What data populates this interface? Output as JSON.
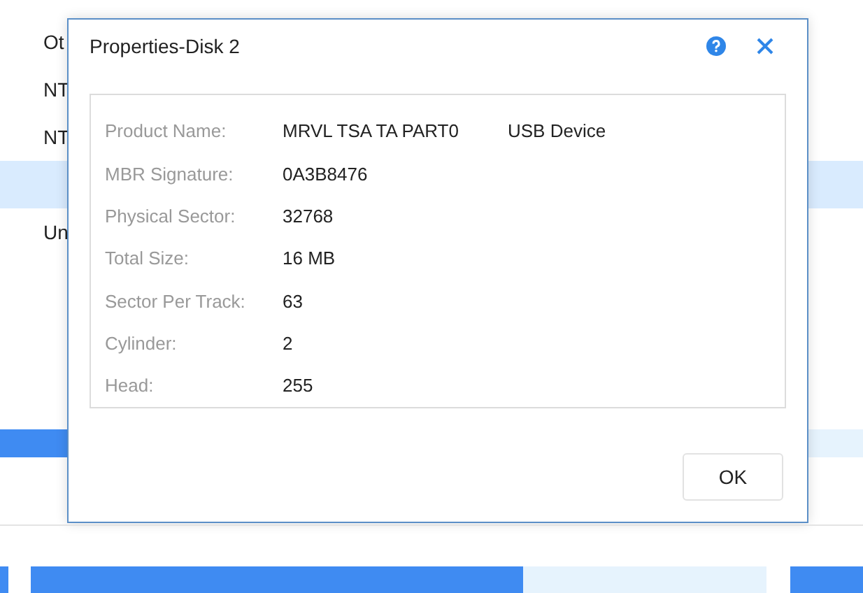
{
  "background": {
    "rows": [
      {
        "label": "Ot",
        "selected": false
      },
      {
        "label": "NT",
        "selected": false
      },
      {
        "label": "NT",
        "selected": false
      },
      {
        "label": "",
        "selected": true
      },
      {
        "label": "Un",
        "selected": false
      }
    ],
    "disk_bar": {
      "level": 0.67
    }
  },
  "dialog": {
    "title": "Properties-Disk 2",
    "properties": [
      {
        "label": "Product Name:",
        "values": [
          "MRVL TSA TA PART0",
          "USB Device"
        ]
      },
      {
        "label": "MBR Signature:",
        "values": [
          "0A3B8476"
        ]
      },
      {
        "label": "Physical Sector:",
        "values": [
          "32768"
        ]
      },
      {
        "label": "Total Size:",
        "values": [
          "16 MB"
        ]
      },
      {
        "label": "Sector Per Track:",
        "values": [
          "63"
        ]
      },
      {
        "label": "Cylinder:",
        "values": [
          "2"
        ]
      },
      {
        "label": "Head:",
        "values": [
          "255"
        ]
      }
    ],
    "buttons": [
      "OK"
    ]
  }
}
